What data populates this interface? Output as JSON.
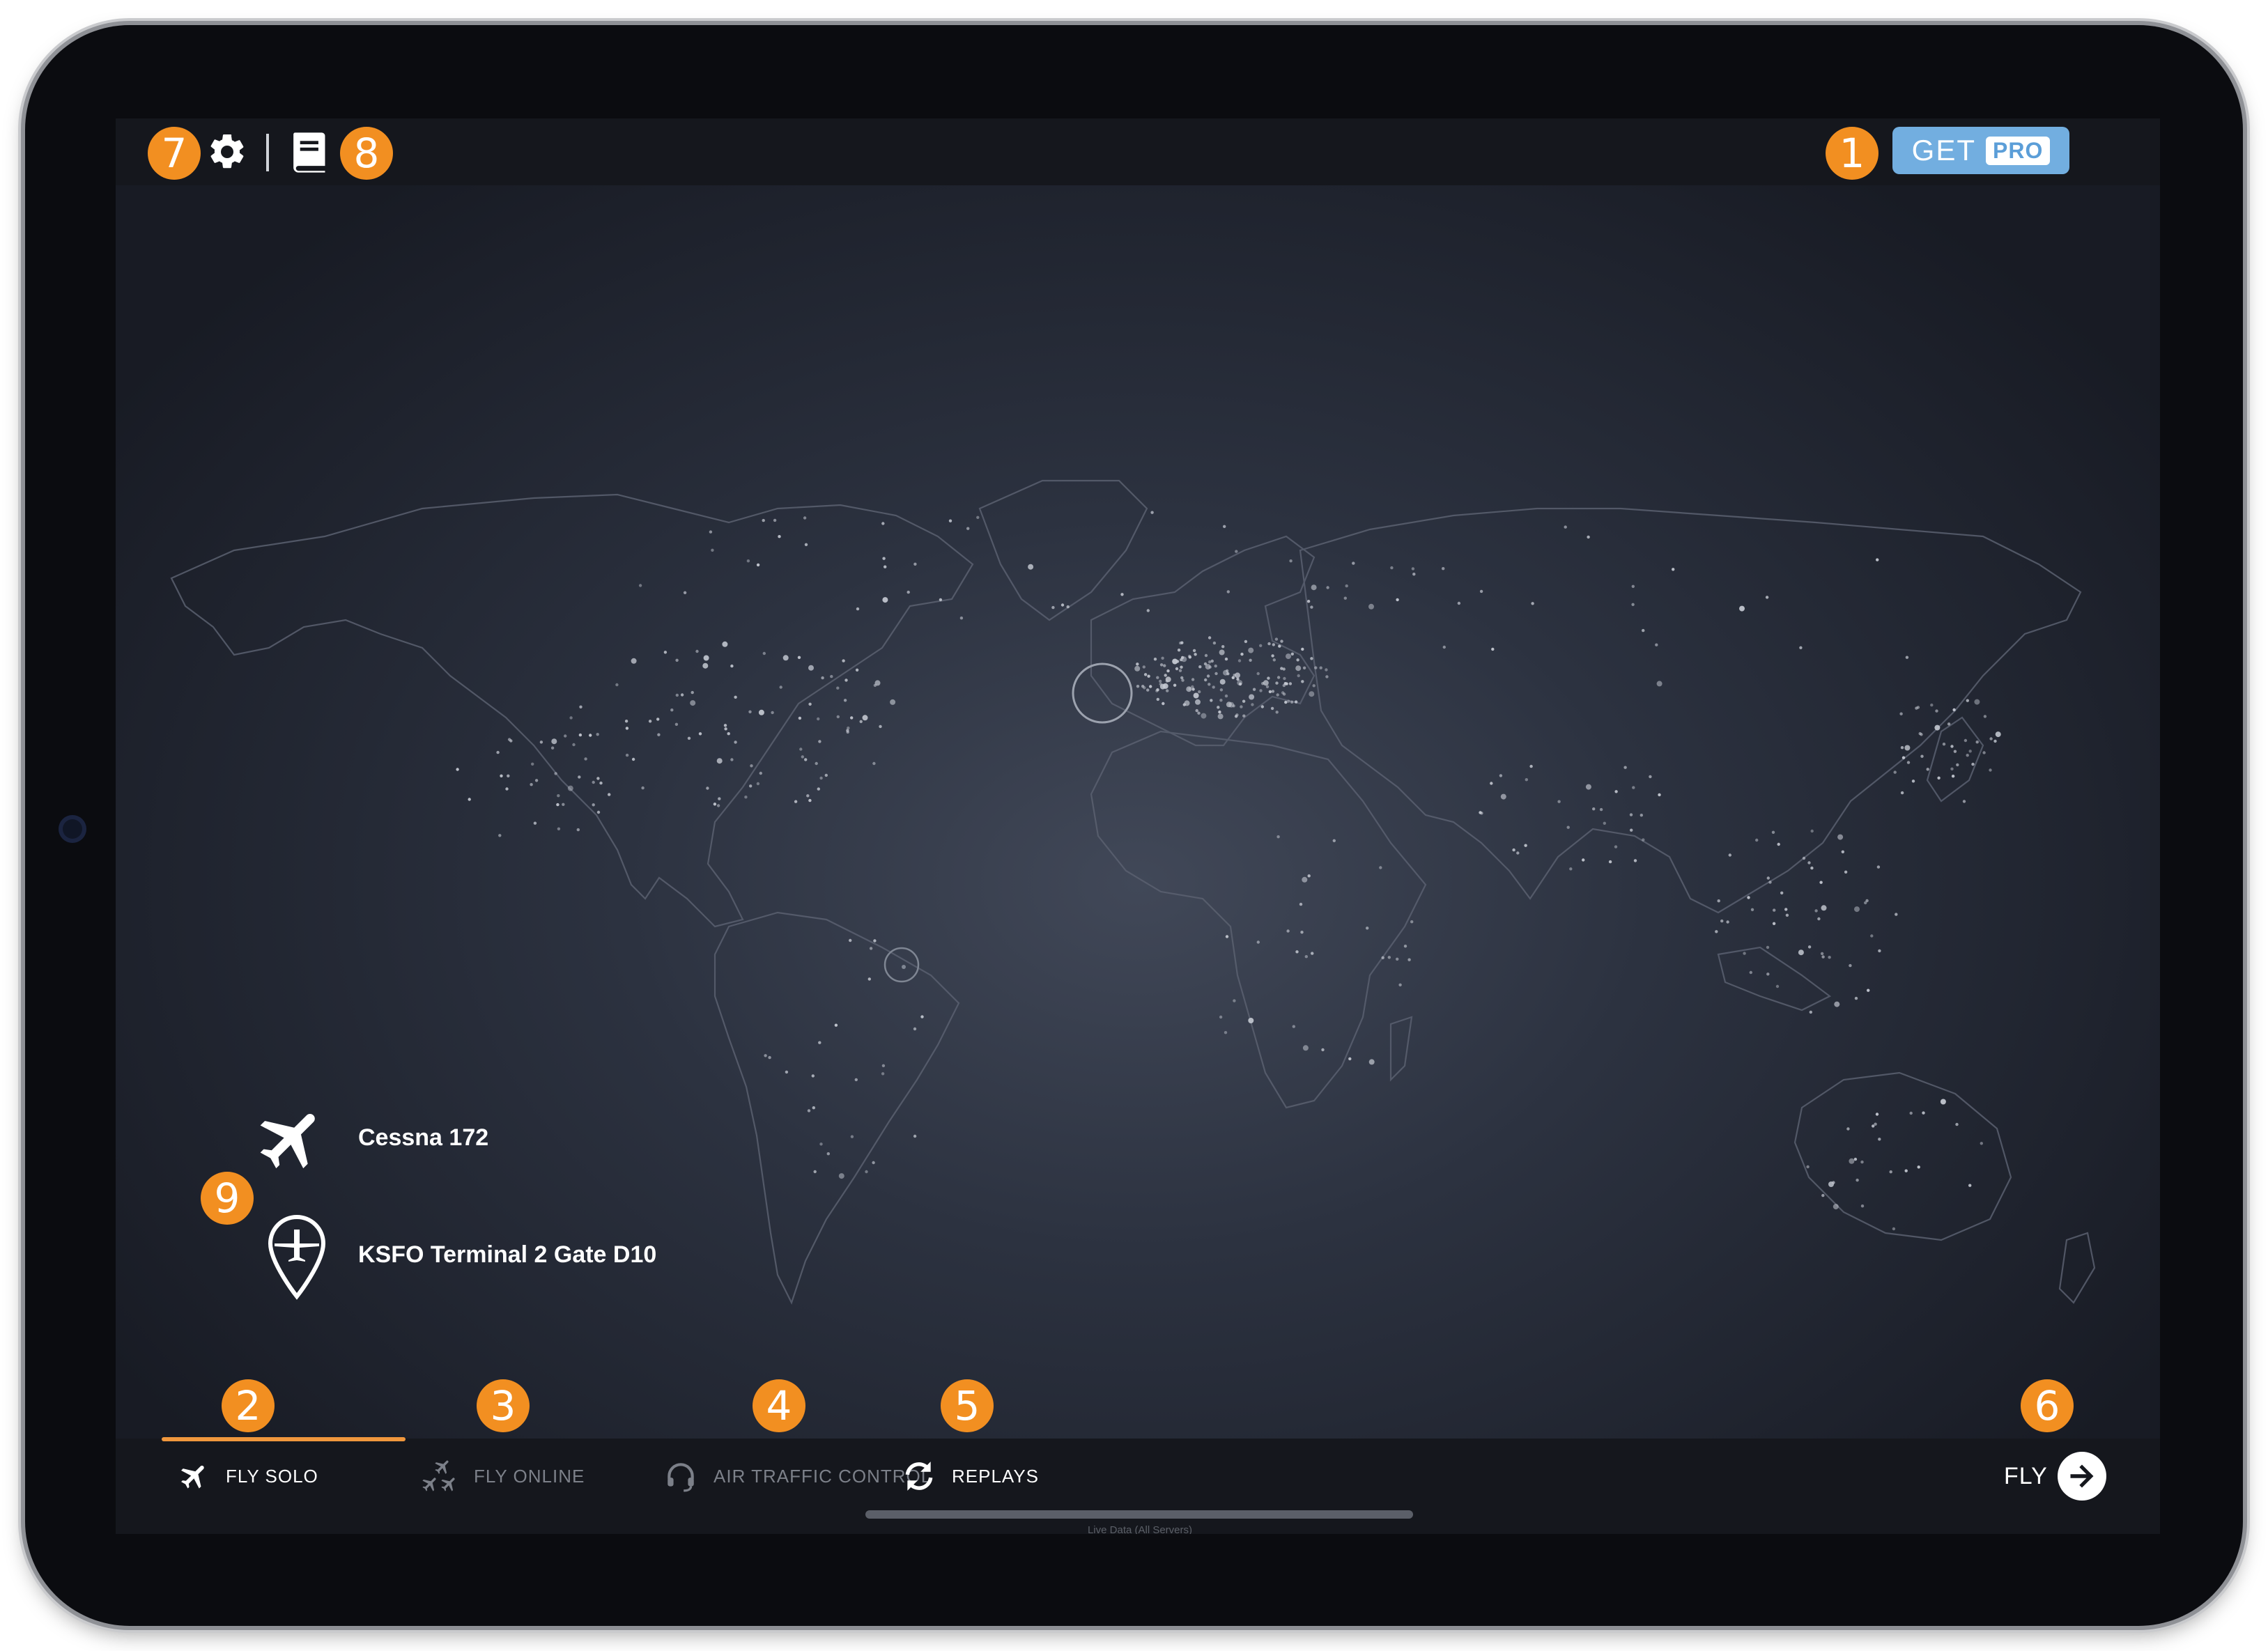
{
  "toolbar": {
    "settings_icon": "gear-icon",
    "manual_icon": "book-icon",
    "get_label": "GET",
    "pro_label": "PRO"
  },
  "selection": {
    "aircraft": "Cessna 172",
    "aircraft_icon": "airplane-icon",
    "location": "KSFO Terminal 2 Gate D10",
    "location_icon": "map-pin-airplane-icon"
  },
  "tabs": [
    {
      "label": "FLY SOLO",
      "icon": "airplane-icon",
      "state": "active"
    },
    {
      "label": "FLY ONLINE",
      "icon": "multiple-airplanes-icon",
      "state": "disabled"
    },
    {
      "label": "AIR TRAFFIC CONTROL",
      "icon": "headset-icon",
      "state": "disabled"
    },
    {
      "label": "REPLAYS",
      "icon": "refresh-icon",
      "state": "enabled"
    }
  ],
  "fly_button": {
    "label": "FLY",
    "icon": "arrow-right-circle-icon"
  },
  "footer": {
    "live_data": "Live Data (All Servers)"
  },
  "callouts": [
    "1",
    "2",
    "3",
    "4",
    "5",
    "6",
    "7",
    "8",
    "9"
  ],
  "colors": {
    "accent": "#f28f21",
    "pro_button": "#72aee0",
    "active_tab_underline": "#f0973d",
    "bar_background": "#15171d"
  }
}
